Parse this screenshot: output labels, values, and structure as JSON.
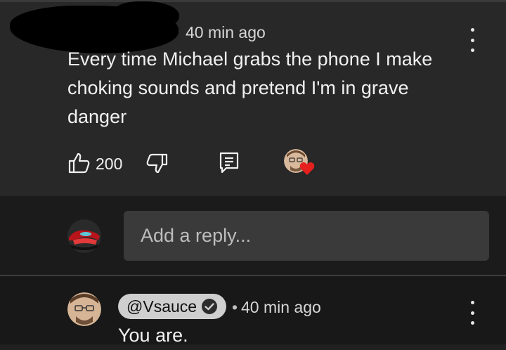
{
  "comment": {
    "timestamp": "40 min ago",
    "text_lines": [
      "Every time Michael grabs the phone I make",
      "choking sounds and pretend I'm in grave",
      "danger"
    ],
    "like_count": "200",
    "icons": {
      "menu": "more-vertical-icon",
      "like": "thumbs-up-icon",
      "dislike": "thumbs-down-icon",
      "reply": "reply-icon",
      "creator_heart": "creator-heart-icon"
    }
  },
  "reply_box": {
    "placeholder": "Add a reply..."
  },
  "reply": {
    "handle": "@Vsauce",
    "separator": "•",
    "timestamp": "40 min ago",
    "text": "You are.",
    "icons": {
      "verified": "verified-check-icon",
      "menu": "more-vertical-icon"
    }
  },
  "colors": {
    "comment_bg": "#282828",
    "reply_bar_bg": "#1b1b1b",
    "input_bg": "#3a3a3a",
    "handle_chip_bg": "#cfcfcf",
    "heart": "#e5201f"
  }
}
